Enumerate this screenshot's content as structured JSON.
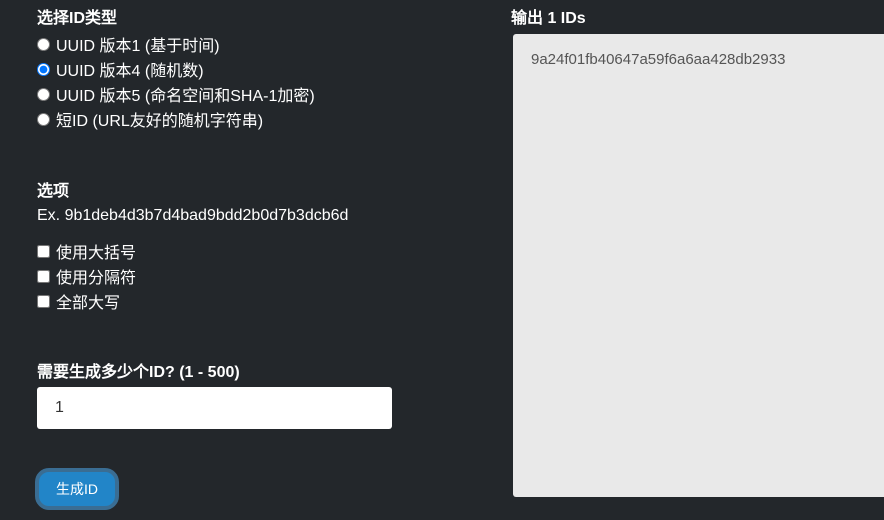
{
  "type_section": {
    "title": "选择ID类型",
    "options": [
      {
        "label": "UUID 版本1 (基于时间)",
        "checked": false
      },
      {
        "label": "UUID 版本4 (随机数)",
        "checked": true
      },
      {
        "label": "UUID 版本5 (命名空间和SHA-1加密)",
        "checked": false
      },
      {
        "label": "短ID (URL友好的随机字符串)",
        "checked": false
      }
    ]
  },
  "options_section": {
    "title": "选项",
    "example": "Ex. 9b1deb4d3b7d4bad9bdd2b0d7b3dcb6d",
    "checkboxes": [
      {
        "label": "使用大括号",
        "checked": false
      },
      {
        "label": "使用分隔符",
        "checked": false
      },
      {
        "label": "全部大写",
        "checked": false
      }
    ]
  },
  "count_section": {
    "title": "需要生成多少个ID? (1 - 500)",
    "value": "1"
  },
  "generate_button": "生成ID",
  "output": {
    "title": "输出 1 IDs",
    "text": "9a24f01fb40647a59f6a6aa428db2933"
  }
}
